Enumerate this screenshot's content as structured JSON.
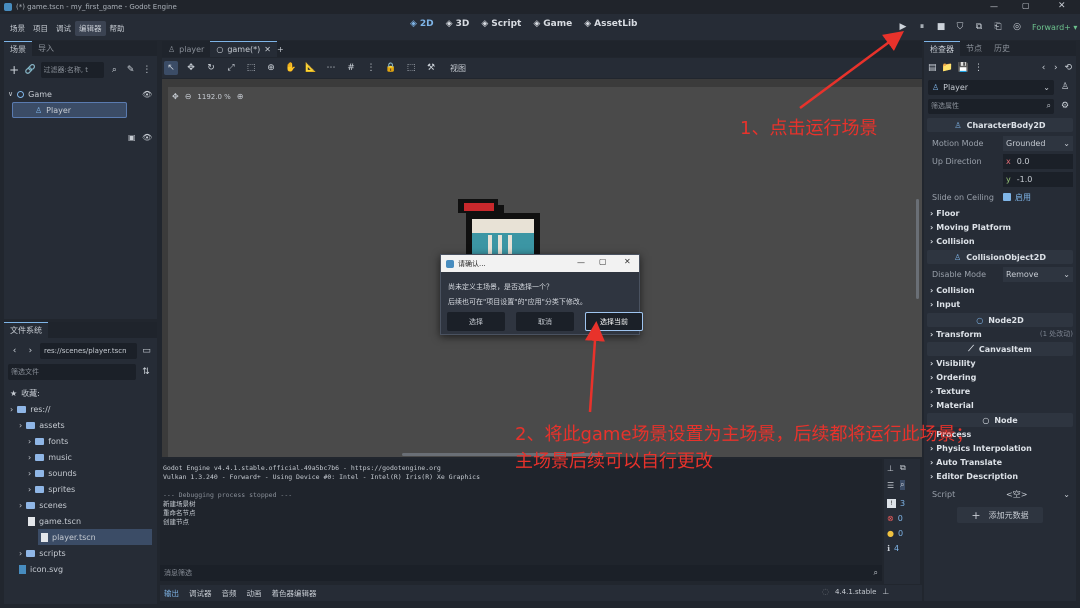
{
  "window": {
    "title": "(*) game.tscn - my_first_game - Godot Engine"
  },
  "menu": [
    "场景",
    "项目",
    "调试",
    "编辑器",
    "帮助"
  ],
  "workspaces": [
    {
      "label": "2D",
      "icon": "2d-icon"
    },
    {
      "label": "3D",
      "icon": "3d-icon"
    },
    {
      "label": "Script",
      "icon": "script-icon"
    },
    {
      "label": "Game",
      "icon": "game-icon"
    },
    {
      "label": "AssetLib",
      "icon": "assetlib-icon"
    }
  ],
  "renderer": "Forward+ ▾",
  "scene_dock": {
    "tabs": [
      "场景",
      "导入"
    ],
    "filter_placeholder": "过滤器:名称, t",
    "nodes": [
      "Game",
      "Player"
    ]
  },
  "filesystem": {
    "tab": "文件系统",
    "path": "res://scenes/player.tscn",
    "filter_placeholder": "筛选文件",
    "items": [
      {
        "label": "收藏:",
        "type": "star",
        "depth": 0
      },
      {
        "label": "res://",
        "type": "folder",
        "depth": 0
      },
      {
        "label": "assets",
        "type": "folder",
        "depth": 1
      },
      {
        "label": "fonts",
        "type": "folder",
        "depth": 2
      },
      {
        "label": "music",
        "type": "folder",
        "depth": 2
      },
      {
        "label": "sounds",
        "type": "folder",
        "depth": 2
      },
      {
        "label": "sprites",
        "type": "folder",
        "depth": 2
      },
      {
        "label": "scenes",
        "type": "folder",
        "depth": 1
      },
      {
        "label": "game.tscn",
        "type": "scene",
        "depth": 2
      },
      {
        "label": "player.tscn",
        "type": "scene",
        "depth": 2,
        "selected": true
      },
      {
        "label": "scripts",
        "type": "folder",
        "depth": 1
      },
      {
        "label": "icon.svg",
        "type": "svg",
        "depth": 1
      }
    ]
  },
  "editor_tabs": [
    "player",
    "game(*)"
  ],
  "toolbar": {
    "view": "视图"
  },
  "viewport": {
    "zoom": "1192.0 %"
  },
  "dialog": {
    "title": "请确认...",
    "line1": "尚未定义主场景，是否选择一个？",
    "line2": "后续也可在\"项目设置\"的\"应用\"分类下修改。",
    "buttons": [
      "选择",
      "取消",
      "选择当前"
    ]
  },
  "output": {
    "lines": [
      "Godot Engine v4.4.1.stable.official.49a5bc7b6 - https://godotengine.org",
      "Vulkan 1.3.240 - Forward+ - Using Device #0: Intel - Intel(R) Iris(R) Xe Graphics",
      "",
      "--- Debugging process stopped ---",
      "新建场景树",
      "重命名节点",
      "创建节点"
    ],
    "filter_placeholder": "消息筛选",
    "counts": [
      "3",
      "0",
      "0",
      "4"
    ]
  },
  "bottom_tabs": [
    "输出",
    "调试器",
    "音频",
    "动画",
    "着色器编辑器"
  ],
  "version": "4.4.1.stable",
  "inspector": {
    "tabs": [
      "检查器",
      "节点",
      "历史"
    ],
    "node": "Player",
    "filter_placeholder": "筛选属性",
    "class_character": "CharacterBody2D",
    "motion_mode_label": "Motion Mode",
    "motion_mode_value": "Grounded",
    "up_direction_label": "Up Direction",
    "up_x": "0.0",
    "up_y": "-1.0",
    "slide_label": "Slide on Ceiling",
    "slide_value": "启用",
    "groups_character": [
      "Floor",
      "Moving Platform",
      "Collision"
    ],
    "class_collision": "CollisionObject2D",
    "disable_mode_label": "Disable Mode",
    "disable_mode_value": "Remove",
    "groups_collision": [
      "Collision",
      "Input"
    ],
    "class_node2d": "Node2D",
    "transform_label": "Transform",
    "transform_note": "(1 处改动)",
    "class_canvas": "CanvasItem",
    "groups_canvas": [
      "Visibility",
      "Ordering",
      "Texture",
      "Material"
    ],
    "class_node": "Node",
    "groups_node": [
      "Process",
      "Physics Interpolation",
      "Auto Translate",
      "Editor Description"
    ],
    "script_label": "Script",
    "script_value": "<空>",
    "add_metadata": "添加元数据"
  },
  "annotations": {
    "step1": "1、点击运行场景",
    "step2_line1": "2、将此game场景设置为主场景，后续都将运行此场景；",
    "step2_line2": "主场景后续可以自行更改"
  },
  "colors": {
    "accent": "#7fb5e8",
    "annotation": "#e8322b",
    "viewport": "#4a4a4a"
  }
}
